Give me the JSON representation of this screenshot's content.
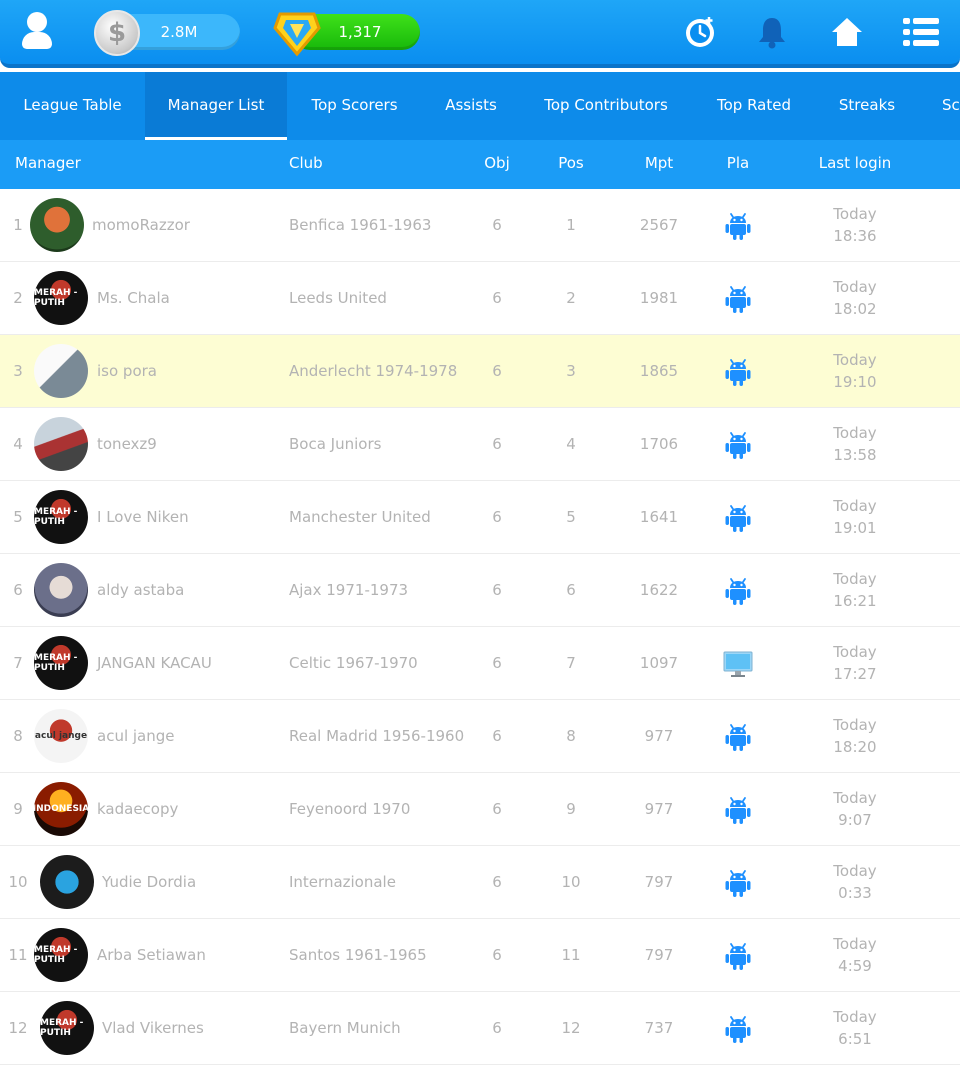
{
  "topbar": {
    "coins": "2.8M",
    "gems": "1,317",
    "icons": [
      "user-icon",
      "coin-icon",
      "gem-icon",
      "clock-icon",
      "bell-icon",
      "home-icon",
      "menu-icon"
    ]
  },
  "tabs": [
    {
      "label": "League Table"
    },
    {
      "label": "Manager List"
    },
    {
      "label": "Top Scorers"
    },
    {
      "label": "Assists"
    },
    {
      "label": "Top Contributors"
    },
    {
      "label": "Top Rated"
    },
    {
      "label": "Streaks"
    },
    {
      "label": "Sc"
    }
  ],
  "active_tab": "Manager List",
  "columns": {
    "manager": "Manager",
    "club": "Club",
    "obj": "Obj",
    "pos": "Pos",
    "mpt": "Mpt",
    "pla": "Pla",
    "last_login": "Last login"
  },
  "rows": [
    {
      "rank": "1",
      "name": "momoRazzor",
      "club": "Benfica 1961-1963",
      "obj": "6",
      "pos": "1",
      "mpt": "2567",
      "platform": "android",
      "login_day": "Today",
      "login_time": "18:36",
      "pic_text": ""
    },
    {
      "rank": "2",
      "name": "Ms. Chala",
      "club": "Leeds United",
      "obj": "6",
      "pos": "2",
      "mpt": "1981",
      "platform": "android",
      "login_day": "Today",
      "login_time": "18:02",
      "pic_text": "MERAH - PUTIH"
    },
    {
      "rank": "3",
      "name": "iso pora",
      "club": "Anderlecht 1974-1978",
      "obj": "6",
      "pos": "3",
      "mpt": "1865",
      "platform": "android",
      "login_day": "Today",
      "login_time": "19:10",
      "pic_text": ""
    },
    {
      "rank": "4",
      "name": "tonexz9",
      "club": "Boca Juniors",
      "obj": "6",
      "pos": "4",
      "mpt": "1706",
      "platform": "android",
      "login_day": "Today",
      "login_time": "13:58",
      "pic_text": ""
    },
    {
      "rank": "5",
      "name": "I Love Niken",
      "club": "Manchester United",
      "obj": "6",
      "pos": "5",
      "mpt": "1641",
      "platform": "android",
      "login_day": "Today",
      "login_time": "19:01",
      "pic_text": "MERAH - PUTIH"
    },
    {
      "rank": "6",
      "name": "aldy astaba",
      "club": "Ajax 1971-1973",
      "obj": "6",
      "pos": "6",
      "mpt": "1622",
      "platform": "android",
      "login_day": "Today",
      "login_time": "16:21",
      "pic_text": ""
    },
    {
      "rank": "7",
      "name": "JANGAN KACAU",
      "club": "Celtic 1967-1970",
      "obj": "6",
      "pos": "7",
      "mpt": "1097",
      "platform": "desktop",
      "login_day": "Today",
      "login_time": "17:27",
      "pic_text": "MERAH - PUTIH"
    },
    {
      "rank": "8",
      "name": "acul jange",
      "club": "Real Madrid 1956-1960",
      "obj": "6",
      "pos": "8",
      "mpt": "977",
      "platform": "android",
      "login_day": "Today",
      "login_time": "18:20",
      "pic_text": "acul jange"
    },
    {
      "rank": "9",
      "name": "kadaecopy",
      "club": "Feyenoord 1970",
      "obj": "6",
      "pos": "9",
      "mpt": "977",
      "platform": "android",
      "login_day": "Today",
      "login_time": "9:07",
      "pic_text": "INDONESIA"
    },
    {
      "rank": "10",
      "name": "Yudie Dordia",
      "club": "Internazionale",
      "obj": "6",
      "pos": "10",
      "mpt": "797",
      "platform": "android",
      "login_day": "Today",
      "login_time": "0:33",
      "pic_text": ""
    },
    {
      "rank": "11",
      "name": "Arba Setiawan",
      "club": "Santos 1961-1965",
      "obj": "6",
      "pos": "11",
      "mpt": "797",
      "platform": "android",
      "login_day": "Today",
      "login_time": "4:59",
      "pic_text": "MERAH - PUTIH"
    },
    {
      "rank": "12",
      "name": "Vlad Vikernes",
      "club": "Bayern Munich",
      "obj": "6",
      "pos": "12",
      "mpt": "737",
      "platform": "android",
      "login_day": "Today",
      "login_time": "6:51",
      "pic_text": "MERAH - PUTIH"
    }
  ],
  "highlight_row_rank": "3",
  "colors": {
    "topbar": "#0a8ef0",
    "tabs": "#0d8bea",
    "header": "#1b9cf6",
    "highlight": "#fdfdd3",
    "android": "#1e90ff",
    "muted_text": "#b3b3b3"
  }
}
